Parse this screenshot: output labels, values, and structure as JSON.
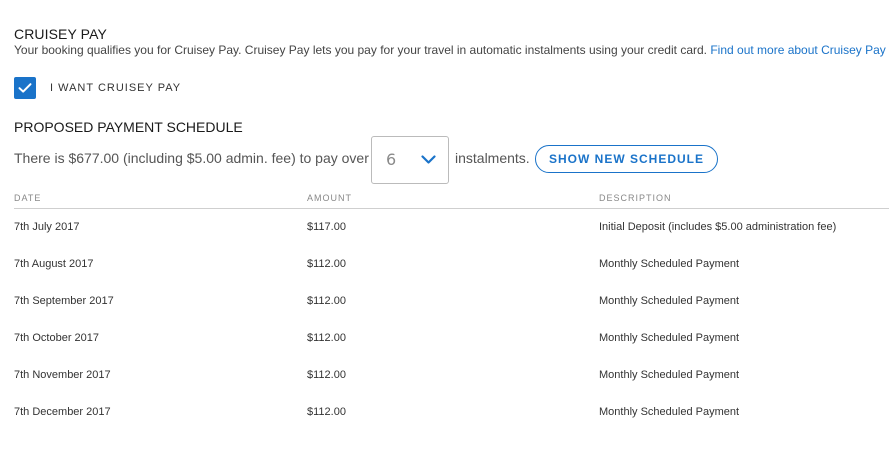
{
  "section": {
    "title": "CRUISEY PAY",
    "intro": "Your booking qualifies you for Cruisey Pay. Cruisey Pay lets you pay for your travel in automatic instalments using your credit card.",
    "link_text": "Find out more about Cruisey Pay"
  },
  "checkbox": {
    "label": "I WANT CRUISEY PAY",
    "checked": true
  },
  "schedule": {
    "title": "PROPOSED PAYMENT SCHEDULE",
    "text_before": "There is $677.00 (including $5.00 admin. fee) to pay over",
    "instalments_value": "6",
    "text_after": "instalments.",
    "button_label": "SHOW NEW SCHEDULE"
  },
  "table": {
    "headers": [
      "DATE",
      "AMOUNT",
      "DESCRIPTION"
    ],
    "rows": [
      {
        "date": "7th July 2017",
        "amount": "$117.00",
        "description": "Initial Deposit (includes $5.00 administration fee)"
      },
      {
        "date": "7th August 2017",
        "amount": "$112.00",
        "description": "Monthly Scheduled Payment"
      },
      {
        "date": "7th September 2017",
        "amount": "$112.00",
        "description": "Monthly Scheduled Payment"
      },
      {
        "date": "7th October 2017",
        "amount": "$112.00",
        "description": "Monthly Scheduled Payment"
      },
      {
        "date": "7th November 2017",
        "amount": "$112.00",
        "description": "Monthly Scheduled Payment"
      },
      {
        "date": "7th December 2017",
        "amount": "$112.00",
        "description": "Monthly Scheduled Payment"
      }
    ]
  },
  "icons": {
    "checkbox": "checkmark-icon",
    "select": "chevron-down-icon"
  },
  "colors": {
    "accent": "#1a73c9",
    "text": "#333333",
    "muted": "#888888"
  }
}
